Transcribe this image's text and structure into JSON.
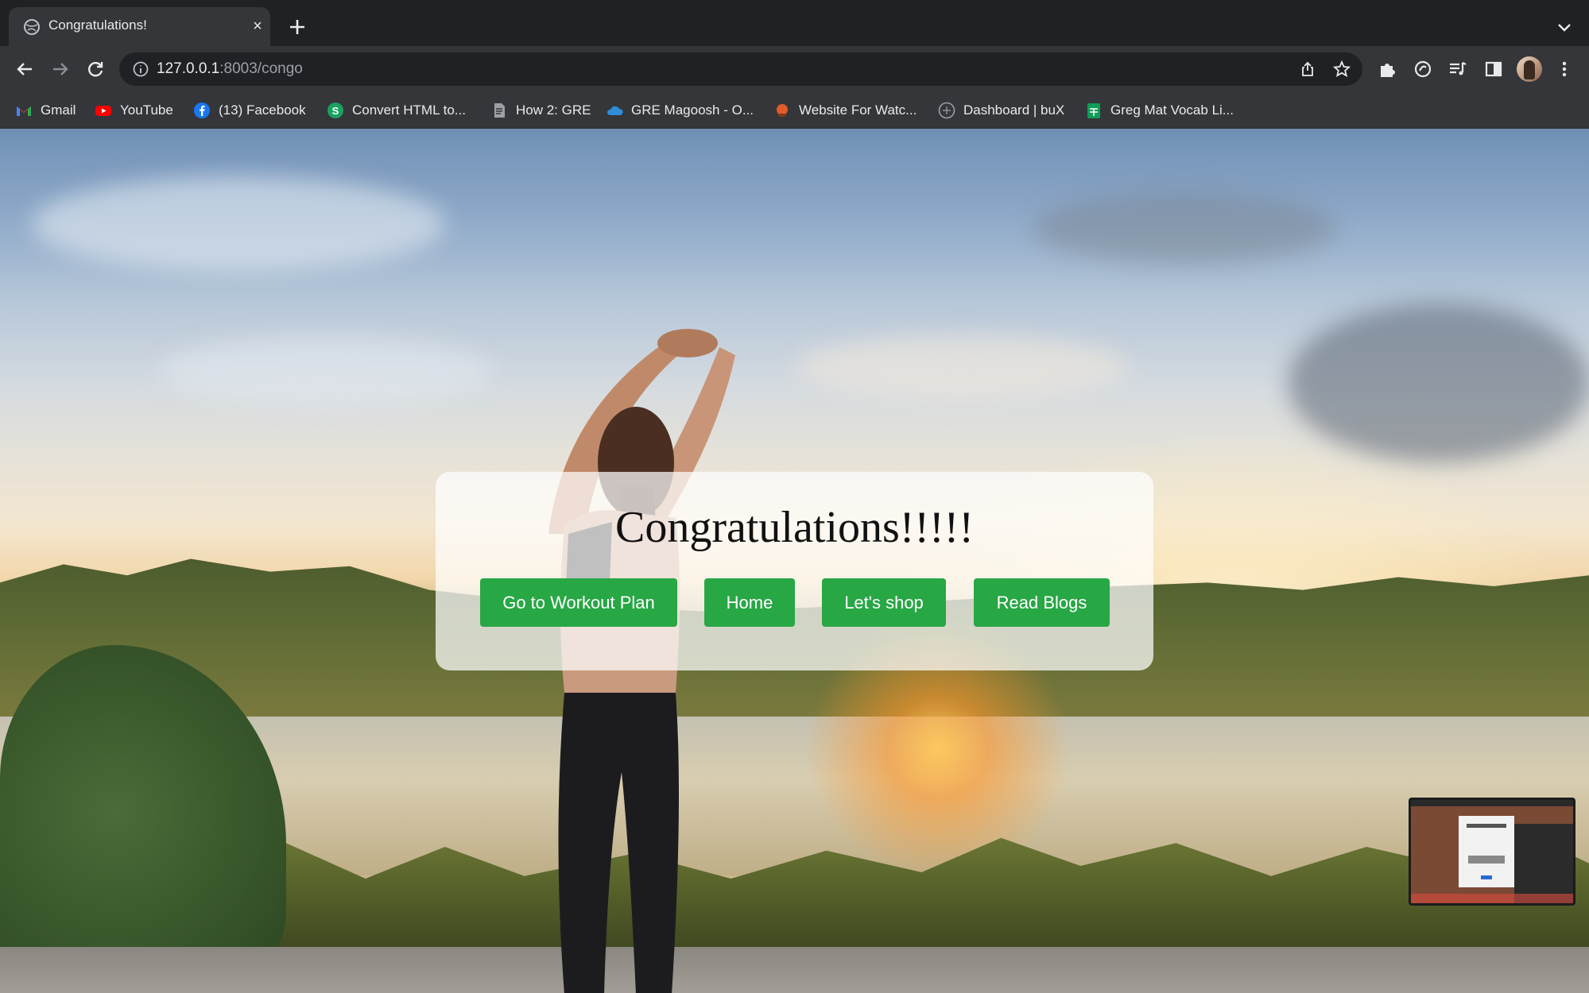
{
  "browser": {
    "tab": {
      "title": "Congratulations!",
      "close_symbol": "×"
    },
    "address": {
      "host": "127.0.0.1",
      "rest": ":8003/congo"
    },
    "bookmarks": [
      {
        "label": "Gmail",
        "icon": "gmail-icon"
      },
      {
        "label": "YouTube",
        "icon": "youtube-icon"
      },
      {
        "label": "(13) Facebook",
        "icon": "facebook-icon"
      },
      {
        "label": "Convert HTML to...",
        "icon": "convert-icon"
      },
      {
        "label": "How 2: GRE",
        "icon": "document-icon"
      },
      {
        "label": "GRE Magoosh - O...",
        "icon": "cloud-icon"
      },
      {
        "label": "Website For Watc...",
        "icon": "website-icon"
      },
      {
        "label": "Dashboard | buX",
        "icon": "dashboard-icon"
      },
      {
        "label": "Greg Mat Vocab Li...",
        "icon": "sheets-icon"
      }
    ]
  },
  "page": {
    "title": "Congratulations!!!!!",
    "buttons": {
      "workout": "Go to Workout Plan",
      "home": "Home",
      "shop": "Let's shop",
      "blogs": "Read Blogs"
    }
  },
  "colors": {
    "button_green": "#28a745",
    "chrome_dark": "#202124",
    "chrome_toolbar": "#35363a"
  }
}
